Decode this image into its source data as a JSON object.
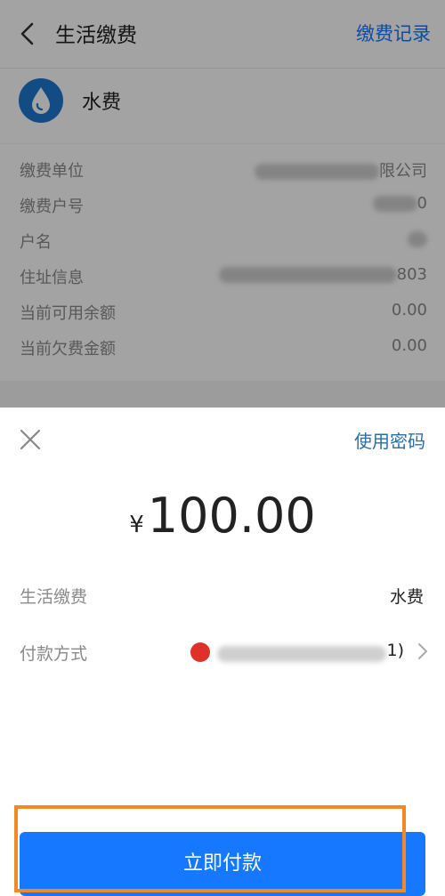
{
  "header": {
    "title": "生活缴费",
    "records_label": "缴费记录"
  },
  "service": {
    "name": "水费",
    "icon": "water-drop-icon"
  },
  "details": [
    {
      "label": "缴费单位",
      "value": "限公司"
    },
    {
      "label": "缴费户号",
      "value": "0"
    },
    {
      "label": "户名",
      "value": ""
    },
    {
      "label": "住址信息",
      "value": "803"
    },
    {
      "label": "当前可用余额",
      "value": "0.00"
    },
    {
      "label": "当前欠费金额",
      "value": "0.00"
    }
  ],
  "sheet": {
    "use_password_label": "使用密码",
    "currency_symbol": "¥",
    "amount": "100.00",
    "rows": {
      "service_label": "生活缴费",
      "service_value": "水费",
      "payment_method_label": "付款方式",
      "payment_method_value": "1)"
    },
    "pay_button_label": "立即付款"
  },
  "colors": {
    "accent": "#1677ff",
    "highlight": "#f08a24",
    "bank": "#e0302a"
  }
}
